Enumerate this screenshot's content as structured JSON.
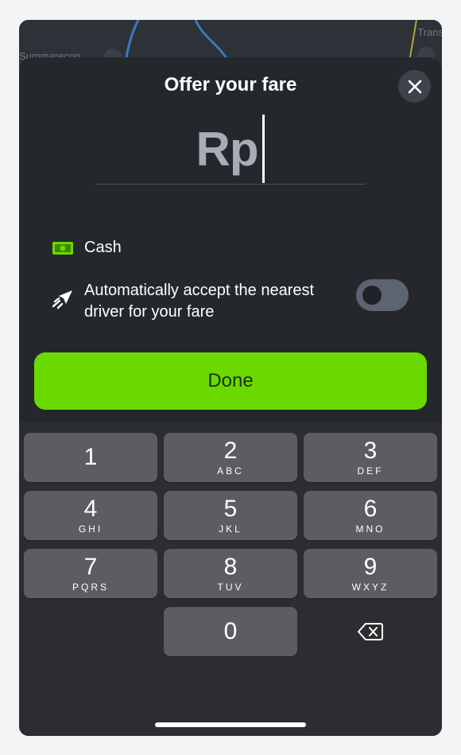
{
  "map": {
    "label_left": "Summarecon",
    "label_right": "Trans"
  },
  "sheet": {
    "title": "Offer your fare",
    "close_icon": "close-icon",
    "currency_symbol": "Rp",
    "payment_method": "Cash",
    "auto_accept_label": "Automatically accept the nearest driver for your fare",
    "auto_accept_enabled": false,
    "done_label": "Done",
    "accent_color": "#6ad900"
  },
  "keypad": {
    "keys": [
      {
        "digit": "1",
        "letters": ""
      },
      {
        "digit": "2",
        "letters": "ABC"
      },
      {
        "digit": "3",
        "letters": "DEF"
      },
      {
        "digit": "4",
        "letters": "GHI"
      },
      {
        "digit": "5",
        "letters": "JKL"
      },
      {
        "digit": "6",
        "letters": "MNO"
      },
      {
        "digit": "7",
        "letters": "PQRS"
      },
      {
        "digit": "8",
        "letters": "TUV"
      },
      {
        "digit": "9",
        "letters": "WXYZ"
      },
      {
        "digit": "0",
        "letters": ""
      }
    ],
    "backspace_icon": "backspace-icon"
  }
}
